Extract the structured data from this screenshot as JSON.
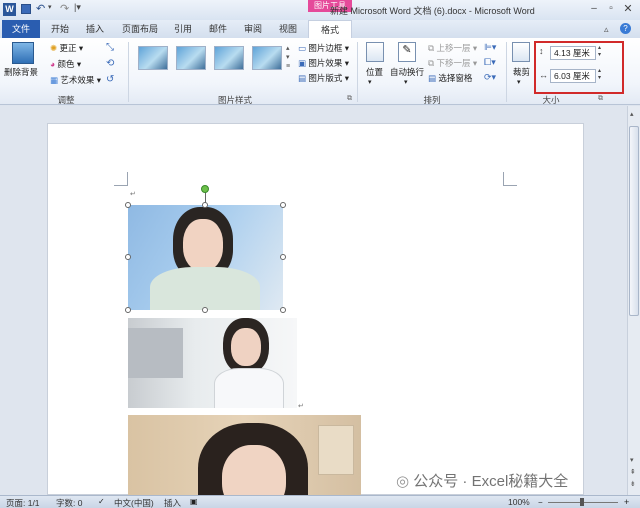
{
  "window": {
    "title": "新建 Microsoft Word 文档 (6).docx - Microsoft Word",
    "contextual_tab_group": "图片工具",
    "qat_icons": [
      "word-logo-icon",
      "save-icon",
      "undo-icon",
      "redo-icon",
      "customize-icon"
    ]
  },
  "tabs": [
    "文件",
    "开始",
    "插入",
    "页面布局",
    "引用",
    "邮件",
    "审阅",
    "视图",
    "格式"
  ],
  "ribbon": {
    "adjust": {
      "remove_bg": "删除背景",
      "corrections": "更正",
      "color": "颜色",
      "artistic": "艺术效果",
      "group_label": "调整"
    },
    "styles": {
      "border": "图片边框",
      "effects": "图片效果",
      "layout": "图片版式",
      "group_label": "图片样式"
    },
    "arrange": {
      "position": "位置",
      "wrap": "自动换行",
      "bring_forward": "上移一层",
      "send_backward": "下移一层",
      "selection_pane": "选择窗格",
      "group_label": "排列"
    },
    "size": {
      "crop": "裁剪",
      "height": "4.13 厘米",
      "width": "6.03 厘米",
      "group_label": "大小"
    }
  },
  "status": {
    "page": "页面: 1/1",
    "words": "字数: 0",
    "language": "中文(中国)",
    "mode": "插入",
    "zoom": "100%"
  },
  "watermark": "公众号 · Excel秘籍大全"
}
